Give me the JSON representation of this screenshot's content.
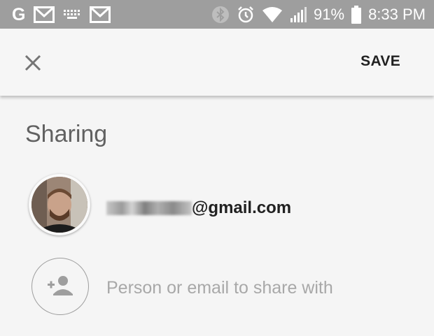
{
  "status_bar": {
    "left_icons": [
      "google-g-icon",
      "gmail-icon",
      "keyboard-icon",
      "gmail-icon"
    ],
    "google_glyph": "G",
    "right_icons": [
      "bluetooth-icon",
      "alarm-icon",
      "wifi-icon",
      "signal-icon",
      "battery-icon"
    ],
    "battery": "91%",
    "time": "8:33 PM"
  },
  "toolbar": {
    "close_icon": "close-icon",
    "save_label": "SAVE"
  },
  "sharing": {
    "title": "Sharing",
    "shared_users": [
      {
        "email_visible": "@gmail.com",
        "avatar": "user-photo"
      }
    ],
    "add_person_icon": "add-person-icon",
    "input_placeholder": "Person or email to share with",
    "input_value": ""
  },
  "colors": {
    "status_bar_bg": "#9e9e9e",
    "toolbar_bg": "#f6f6f6",
    "content_bg": "#f5f5f5",
    "title_text": "#616161",
    "placeholder_text": "#a8a8a8"
  }
}
